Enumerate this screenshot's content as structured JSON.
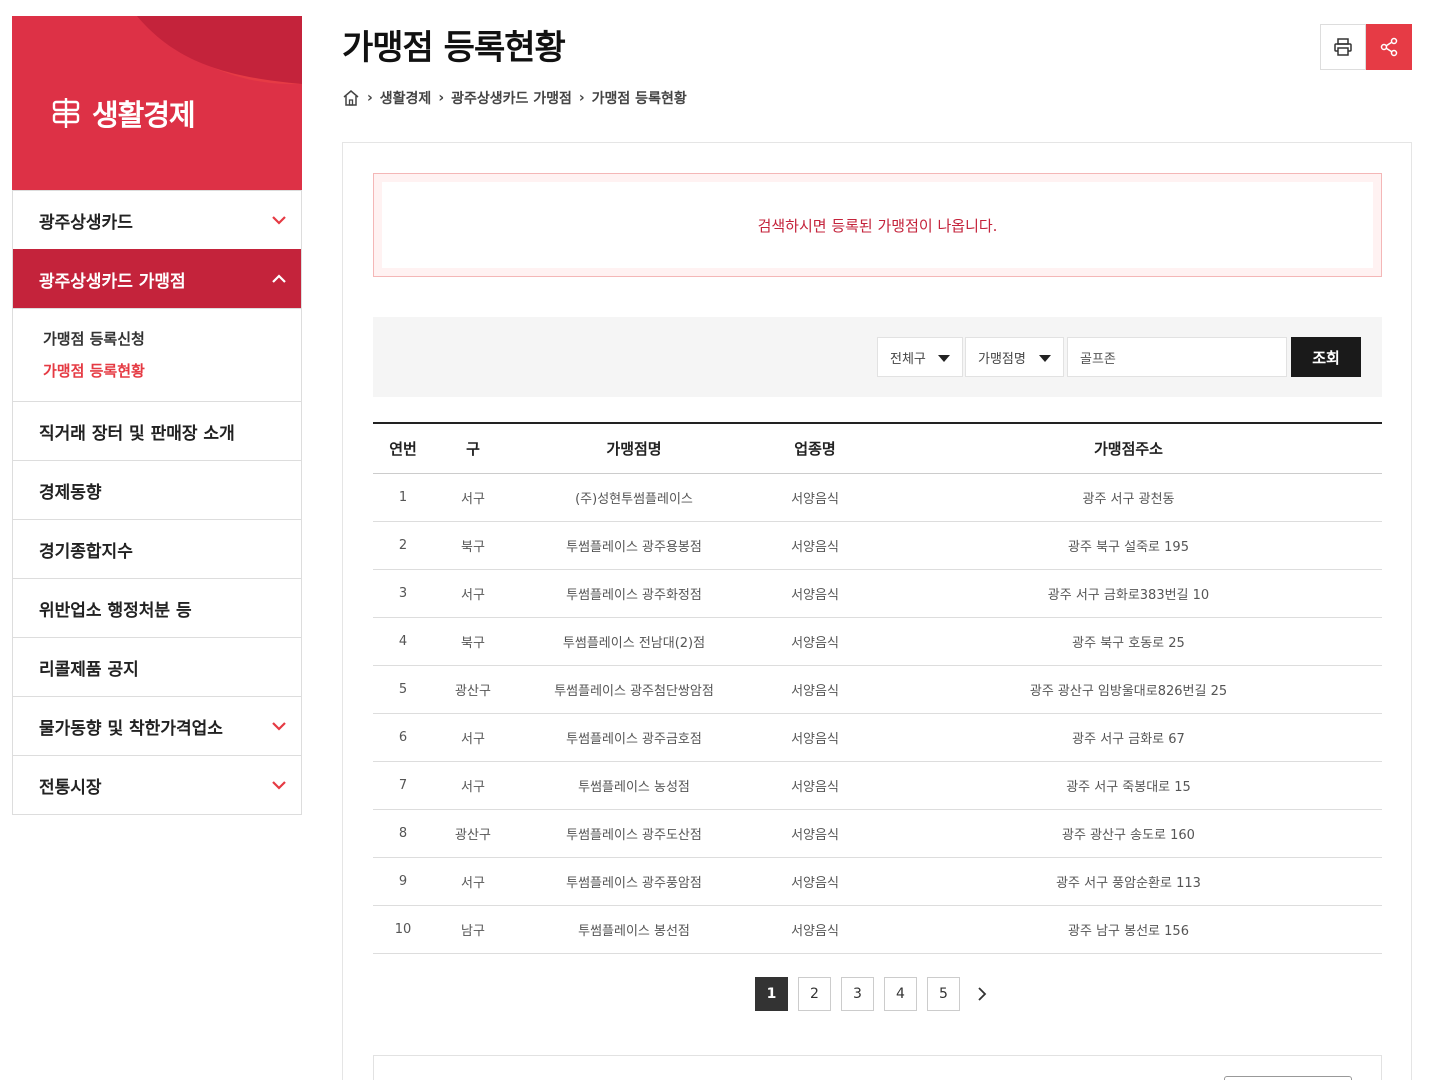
{
  "sidebar": {
    "title": "생활경제",
    "menu": [
      {
        "label": "광주상생카드",
        "chevron": "down"
      },
      {
        "label": "광주상생카드 가맹점",
        "chevron": "up",
        "active": true
      },
      {
        "label": "직거래 장터 및 판매장 소개"
      },
      {
        "label": "경제동향"
      },
      {
        "label": "경기종합지수"
      },
      {
        "label": "위반업소 행정처분 등"
      },
      {
        "label": "리콜제품 공지"
      },
      {
        "label": "물가동향 및 착한가격업소",
        "chevron": "down"
      },
      {
        "label": "전통시장",
        "chevron": "down"
      }
    ],
    "submenu": [
      {
        "label": "가맹점 등록신청"
      },
      {
        "label": "가맹점 등록현황",
        "current": true
      }
    ]
  },
  "header": {
    "title": "가맹점 등록현황",
    "breadcrumb": [
      "생활경제",
      "광주상생카드 가맹점",
      "가맹점 등록현황"
    ],
    "tools": [
      "printer-icon",
      "share-icon"
    ]
  },
  "notice": {
    "text": "검색하시면 등록된 가맹점이 나옵니다."
  },
  "search": {
    "district_selected": "전체구",
    "field_selected": "가맹점명",
    "query": "골프존",
    "button": "조회"
  },
  "table": {
    "headers": [
      "연번",
      "구",
      "가맹점명",
      "업종명",
      "가맹점주소"
    ],
    "rows": [
      [
        "1",
        "서구",
        "(주)성현투썸플레이스",
        "서양음식",
        "광주 서구 광천동"
      ],
      [
        "2",
        "북구",
        "투썸플레이스 광주용봉점",
        "서양음식",
        "광주 북구 설죽로 195"
      ],
      [
        "3",
        "서구",
        "투썸플레이스 광주화정점",
        "서양음식",
        "광주 서구 금화로383번길 10"
      ],
      [
        "4",
        "북구",
        "투썸플레이스 전남대(2)점",
        "서양음식",
        "광주 북구 호동로 25"
      ],
      [
        "5",
        "광산구",
        "투썸플레이스 광주첨단쌍암점",
        "서양음식",
        "광주 광산구 임방울대로826번길 25"
      ],
      [
        "6",
        "서구",
        "투썸플레이스 광주금호점",
        "서양음식",
        "광주 서구 금화로 67"
      ],
      [
        "7",
        "서구",
        "투썸플레이스 농성점",
        "서양음식",
        "광주 서구 죽봉대로 15"
      ],
      [
        "8",
        "광산구",
        "투썸플레이스 광주도산점",
        "서양음식",
        "광주 광산구 송도로 160"
      ],
      [
        "9",
        "서구",
        "투썸플레이스 광주풍암점",
        "서양음식",
        "광주 서구 풍암순환로 113"
      ],
      [
        "10",
        "남구",
        "투썸플레이스 봉선점",
        "서양음식",
        "광주 남구 봉선로 156"
      ]
    ]
  },
  "pagination": {
    "pages": [
      "1",
      "2",
      "3",
      "4",
      "5"
    ],
    "current": "1"
  },
  "colors": {
    "brand_red": "#e63b45",
    "active_menu": "#c4233b",
    "notice_text": "#c4233b"
  }
}
